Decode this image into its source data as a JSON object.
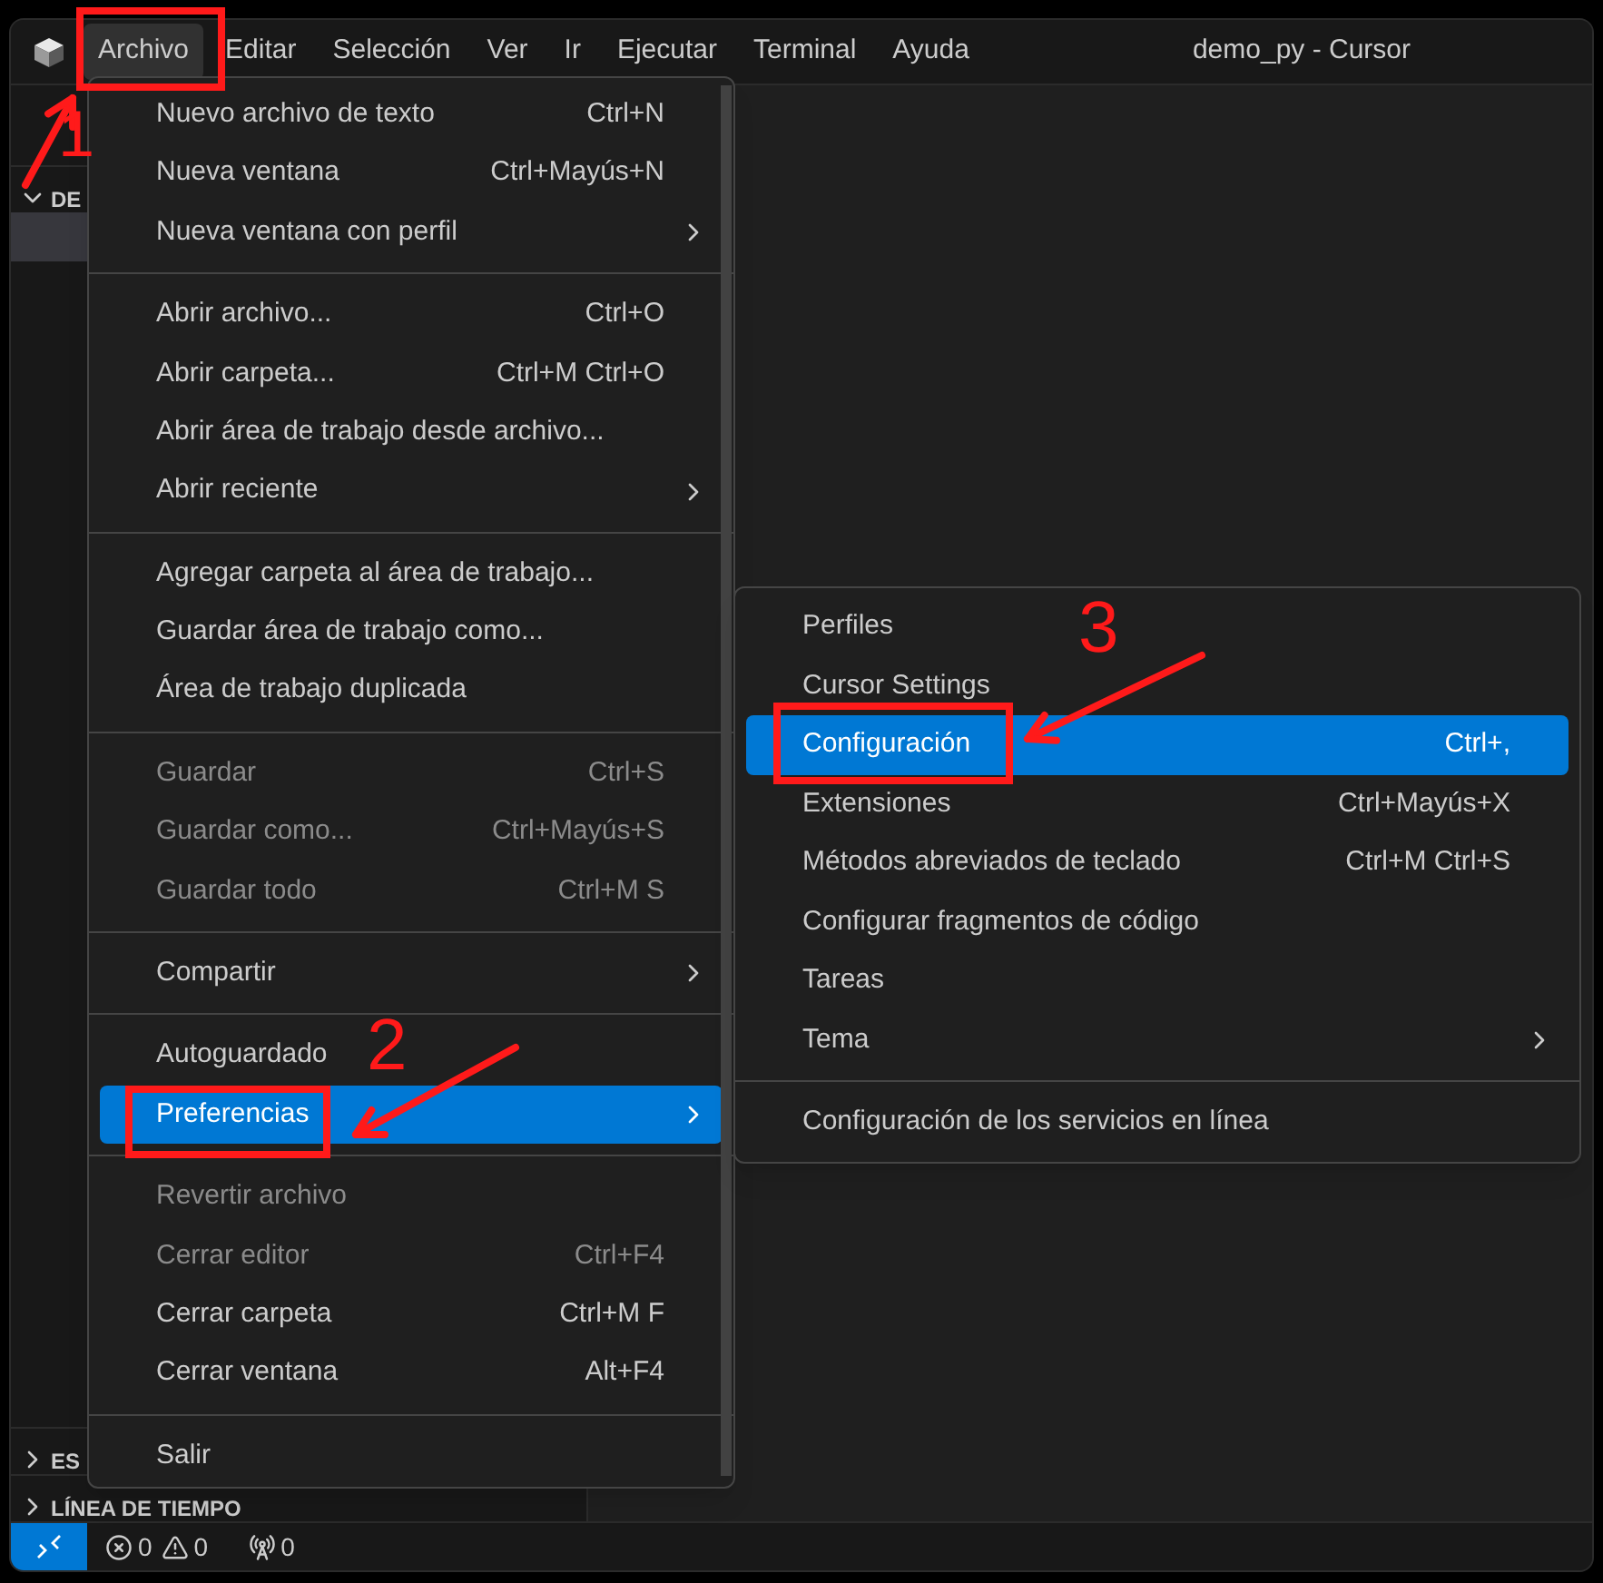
{
  "window": {
    "title": "demo_py - Cursor"
  },
  "menubar": [
    {
      "label": "Archivo",
      "selected": true
    },
    {
      "label": "Editar",
      "selected": false
    },
    {
      "label": "Selección",
      "selected": false
    },
    {
      "label": "Ver",
      "selected": false
    },
    {
      "label": "Ir",
      "selected": false
    },
    {
      "label": "Ejecutar",
      "selected": false
    },
    {
      "label": "Terminal",
      "selected": false
    },
    {
      "label": "Ayuda",
      "selected": false
    }
  ],
  "sidebar": {
    "sections": [
      {
        "title": "DE",
        "expanded": true
      },
      {
        "title": "ES",
        "expanded": false
      },
      {
        "title": "LÍNEA DE TIEMPO",
        "expanded": false
      }
    ]
  },
  "file_menu": {
    "groups": [
      [
        {
          "label": "Nuevo archivo de texto",
          "shortcut": "Ctrl+N",
          "disabled": false,
          "selected": false
        },
        {
          "label": "Nueva ventana",
          "shortcut": "Ctrl+Mayús+N",
          "disabled": false,
          "selected": false
        },
        {
          "label": "Nueva ventana con perfil",
          "submenu": true,
          "disabled": false,
          "selected": false
        }
      ],
      [
        {
          "label": "Abrir archivo...",
          "shortcut": "Ctrl+O",
          "disabled": false,
          "selected": false
        },
        {
          "label": "Abrir carpeta...",
          "shortcut": "Ctrl+M Ctrl+O",
          "disabled": false,
          "selected": false
        },
        {
          "label": "Abrir área de trabajo desde archivo...",
          "disabled": false,
          "selected": false
        },
        {
          "label": "Abrir reciente",
          "submenu": true,
          "disabled": false,
          "selected": false
        }
      ],
      [
        {
          "label": "Agregar carpeta al área de trabajo...",
          "disabled": false,
          "selected": false
        },
        {
          "label": "Guardar área de trabajo como...",
          "disabled": false,
          "selected": false
        },
        {
          "label": "Área de trabajo duplicada",
          "disabled": false,
          "selected": false
        }
      ],
      [
        {
          "label": "Guardar",
          "shortcut": "Ctrl+S",
          "disabled": true,
          "selected": false
        },
        {
          "label": "Guardar como...",
          "shortcut": "Ctrl+Mayús+S",
          "disabled": true,
          "selected": false
        },
        {
          "label": "Guardar todo",
          "shortcut": "Ctrl+M S",
          "disabled": true,
          "selected": false
        }
      ],
      [
        {
          "label": "Compartir",
          "submenu": true,
          "disabled": false,
          "selected": false
        }
      ],
      [
        {
          "label": "Autoguardado",
          "disabled": false,
          "selected": false
        },
        {
          "label": "Preferencias",
          "submenu": true,
          "disabled": false,
          "selected": true
        }
      ],
      [
        {
          "label": "Revertir archivo",
          "disabled": true,
          "selected": false
        },
        {
          "label": "Cerrar editor",
          "shortcut": "Ctrl+F4",
          "disabled": true,
          "selected": false
        },
        {
          "label": "Cerrar carpeta",
          "shortcut": "Ctrl+M F",
          "disabled": false,
          "selected": false
        },
        {
          "label": "Cerrar ventana",
          "shortcut": "Alt+F4",
          "disabled": false,
          "selected": false
        }
      ],
      [
        {
          "label": "Salir",
          "disabled": false,
          "selected": false
        }
      ]
    ]
  },
  "preferences_menu": {
    "groups": [
      [
        {
          "label": "Perfiles",
          "disabled": false,
          "selected": false
        },
        {
          "label": "Cursor Settings",
          "disabled": false,
          "selected": false
        },
        {
          "label": "Configuración",
          "shortcut": "Ctrl+,",
          "disabled": false,
          "selected": true
        },
        {
          "label": "Extensiones",
          "shortcut": "Ctrl+Mayús+X",
          "disabled": false,
          "selected": false
        },
        {
          "label": "Métodos abreviados de teclado",
          "shortcut": "Ctrl+M Ctrl+S",
          "disabled": false,
          "selected": false
        },
        {
          "label": "Configurar fragmentos de código",
          "disabled": false,
          "selected": false
        },
        {
          "label": "Tareas",
          "disabled": false,
          "selected": false
        },
        {
          "label": "Tema",
          "submenu": true,
          "disabled": false,
          "selected": false
        }
      ],
      [
        {
          "label": "Configuración de los servicios en línea",
          "disabled": false,
          "selected": false
        }
      ]
    ]
  },
  "status_bar": {
    "errors": "0",
    "warnings": "0",
    "ports": "0"
  },
  "annotations": [
    {
      "label": "1"
    },
    {
      "label": "2"
    },
    {
      "label": "3"
    }
  ]
}
